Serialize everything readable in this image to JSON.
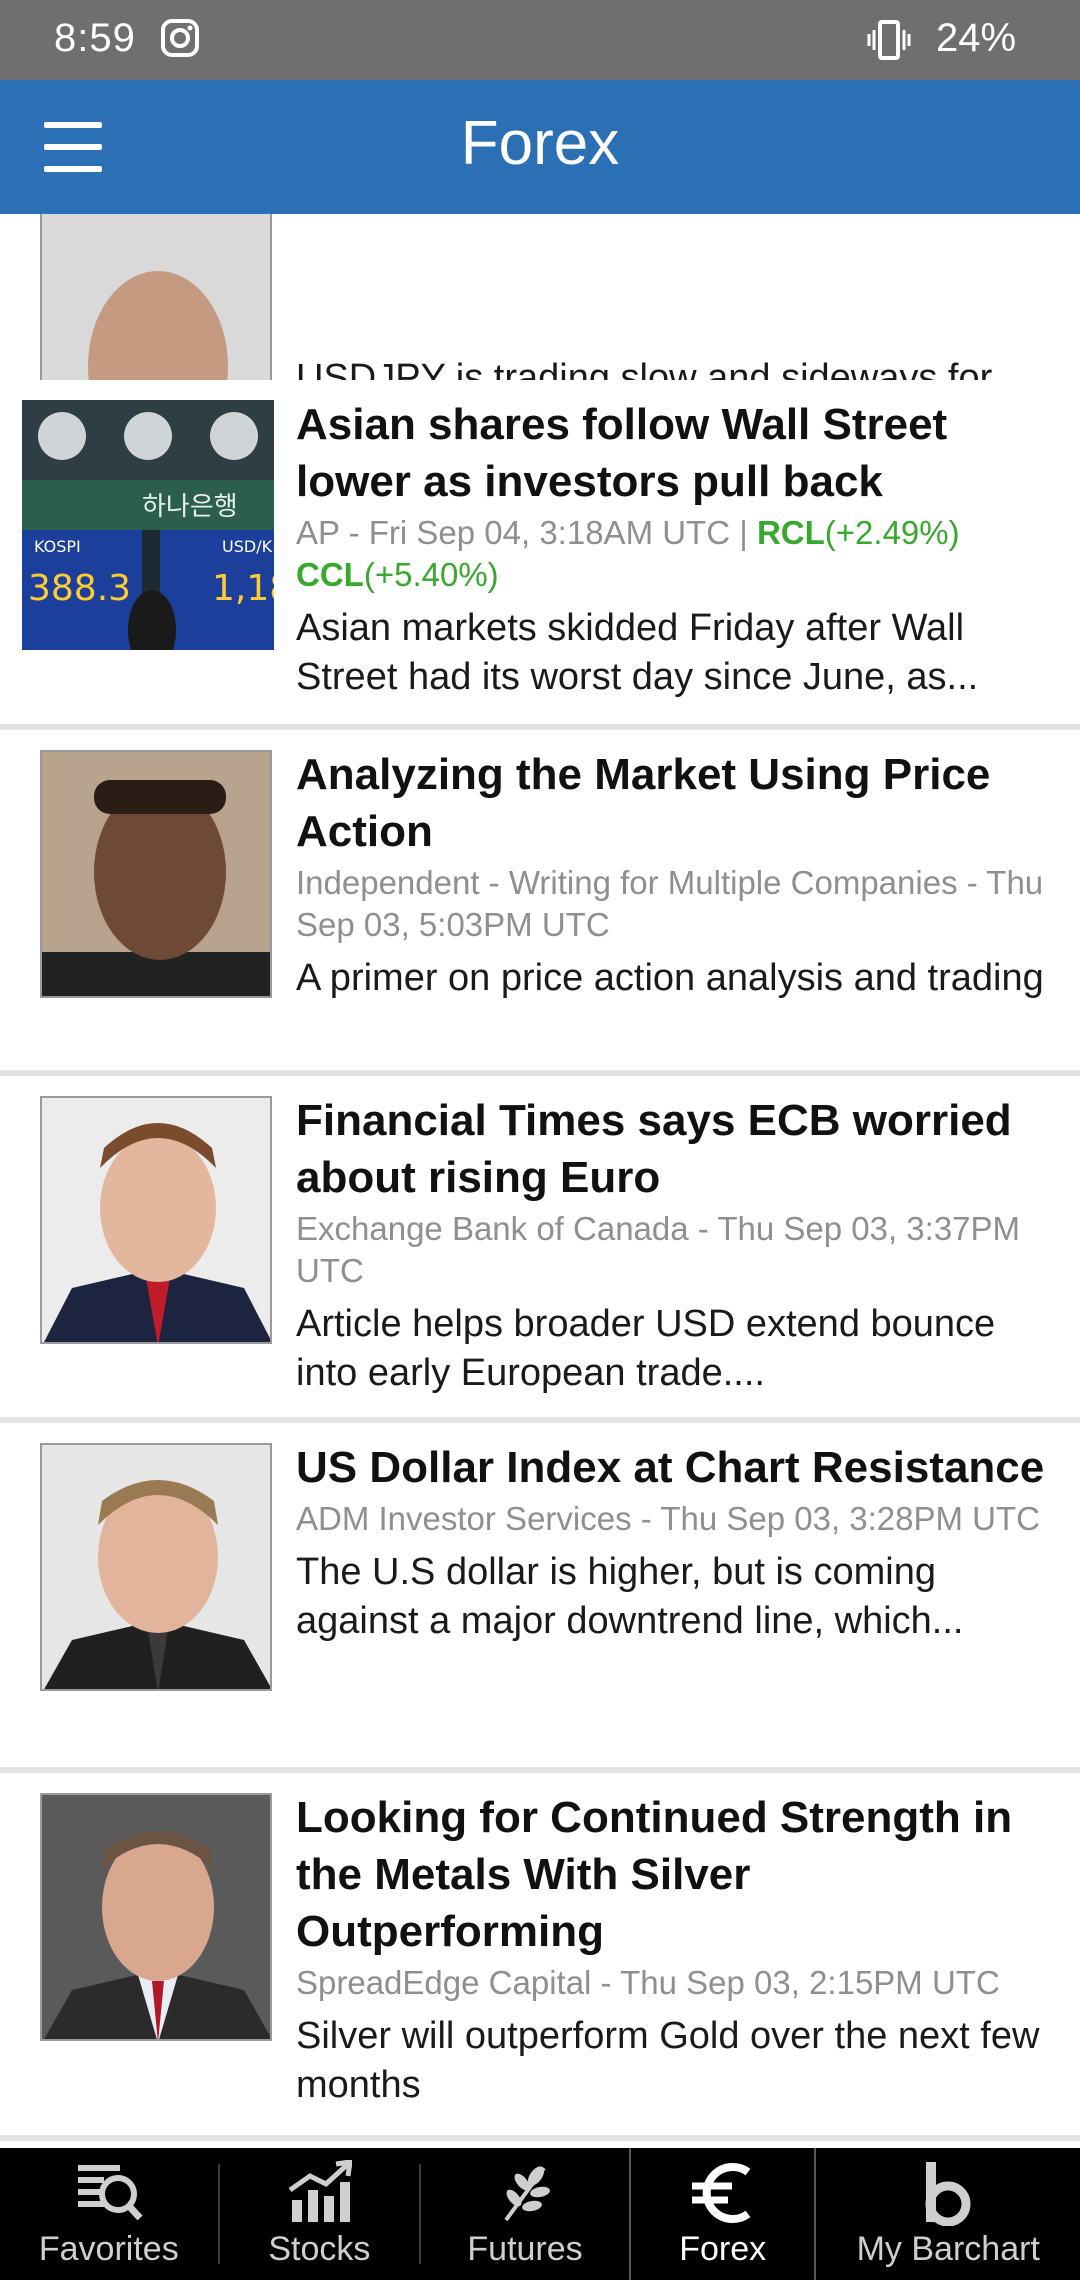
{
  "status_bar": {
    "time": "8:59",
    "battery": "24%",
    "icons": [
      "instagram-icon",
      "vibrate-icon"
    ]
  },
  "app_bar": {
    "title": "Forex",
    "menu_icon": "hamburger-menu-icon"
  },
  "feed": [
    {
      "headline": "",
      "meta": "",
      "summary": "USDJPY is trading slow and sideways for some time now, which resembles a...",
      "thumb": "author-photo"
    },
    {
      "headline": "Asian shares follow Wall Street lower as investors pull back",
      "meta_prefix": "AP - Fri Sep 04, 3:18AM UTC | ",
      "tickers": [
        {
          "symbol": "RCL",
          "change": "(+2.49%)"
        },
        {
          "symbol": "CCL",
          "change": "(+5.40%)"
        }
      ],
      "summary": "Asian markets skidded Friday after Wall Street had its worst day since June, as...",
      "thumb": "market-board-photo"
    },
    {
      "headline": "Analyzing the Market Using Price Action",
      "meta": "Independent - Writing for Multiple Companies - Thu Sep 03, 5:03PM UTC",
      "summary": "A primer on price action analysis and trading",
      "thumb": "author-photo"
    },
    {
      "headline": "Financial Times says ECB worried about rising Euro",
      "meta": "Exchange Bank of Canada - Thu Sep 03, 3:37PM UTC",
      "summary": "Article helps  broader USD extend bounce into early European trade....",
      "thumb": "author-photo"
    },
    {
      "headline": "US Dollar Index at Chart Resistance",
      "meta": "ADM Investor Services - Thu Sep 03, 3:28PM UTC",
      "summary": "The U.S dollar is higher, but is coming against a major downtrend line, which...",
      "thumb": "author-photo"
    },
    {
      "headline": "Looking for Continued Strength in the Metals With Silver Outperforming",
      "meta": "SpreadEdge Capital - Thu Sep 03, 2:15PM UTC",
      "summary": "Silver will outperform Gold over the next few months",
      "thumb": "author-photo"
    }
  ],
  "bottom_nav": [
    {
      "label": "Favorites",
      "icon": "favorites-search-icon"
    },
    {
      "label": "Stocks",
      "icon": "stocks-chart-icon"
    },
    {
      "label": "Futures",
      "icon": "futures-wheat-icon"
    },
    {
      "label": "Forex",
      "icon": "euro-icon",
      "active": true
    },
    {
      "label": "My Barchart",
      "icon": "barchart-b-icon"
    }
  ],
  "colors": {
    "app_bar": "#2b70b4",
    "status_bar": "#6f6f6f",
    "ticker_green": "#38a82f",
    "nav_bg": "#000000"
  }
}
